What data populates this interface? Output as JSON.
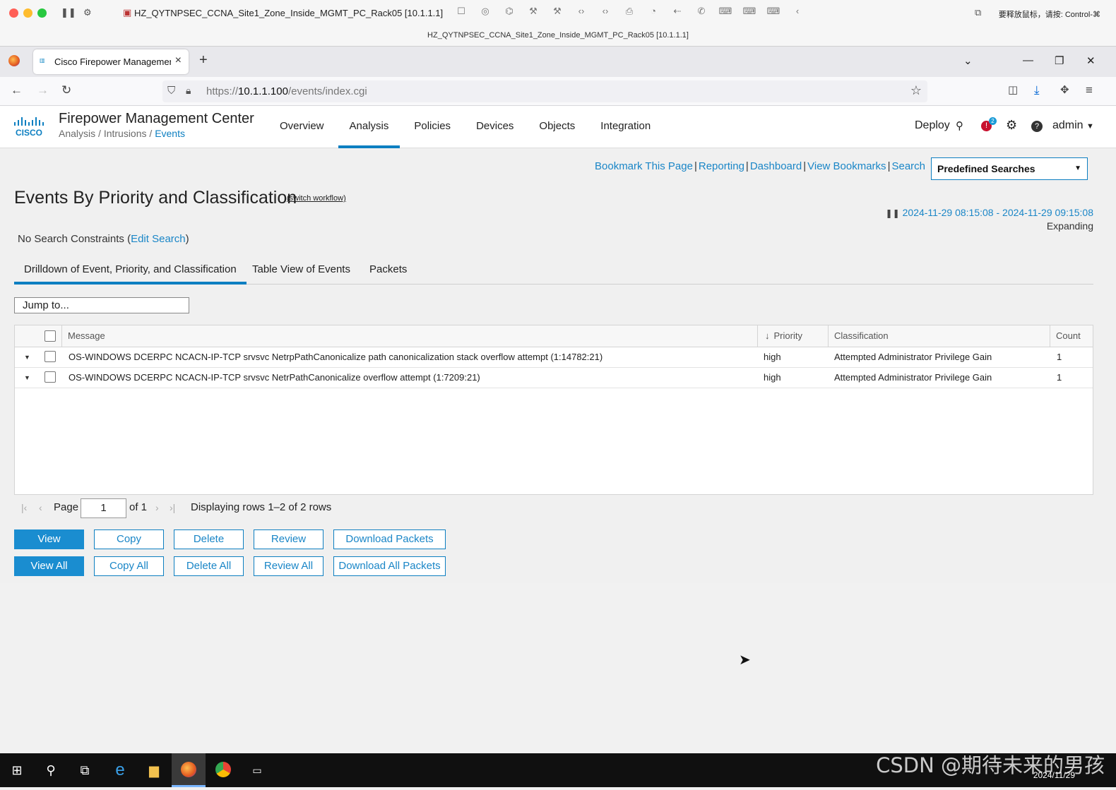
{
  "mac": {
    "title": "HZ_QYTNPSEC_CCNA_Site1_Zone_Inside_MGMT_PC_Rack05 [10.1.1.1]",
    "subtitle": "HZ_QYTNPSEC_CCNA_Site1_Zone_Inside_MGMT_PC_Rack05 [10.1.1.1]",
    "hint": "要释放鼠标，请按: Control-⌘"
  },
  "browser": {
    "tab_title": "Cisco Firepower Management Center",
    "url_prefix": "https://",
    "url_host": "10.1.1.100",
    "url_path": "/events/index.cgi"
  },
  "header": {
    "app_title": "Firepower Management Center",
    "breadcrumb": {
      "part1": "Analysis",
      "sep": " / ",
      "part2": "Intrusions",
      "part3": "Events"
    },
    "nav": [
      "Overview",
      "Analysis",
      "Policies",
      "Devices",
      "Objects",
      "Integration"
    ],
    "active_nav": "Analysis",
    "deploy": "Deploy",
    "alert_count": "2",
    "user": "admin"
  },
  "toolbar": {
    "links": [
      "Bookmark This Page",
      "Reporting",
      "Dashboard",
      "View Bookmarks",
      "Search"
    ],
    "predefined": "Predefined Searches"
  },
  "page": {
    "title": "Events By Priority and Classification",
    "switch_workflow": "(switch workflow)",
    "time_range": "2024-11-29 08:15:08 - 2024-11-29 09:15:08",
    "expanding": "Expanding",
    "constraints_text": "No Search Constraints (",
    "constraints_link": "Edit Search",
    "constraints_end": ")"
  },
  "subtabs": [
    "Drilldown of Event, Priority, and Classification",
    "Table View of Events",
    "Packets"
  ],
  "jump_to": "Jump to...",
  "table": {
    "headers": {
      "message": "Message",
      "priority": "Priority",
      "classification": "Classification",
      "count": "Count"
    },
    "rows": [
      {
        "message": "OS-WINDOWS DCERPC NCACN-IP-TCP srvsvc NetrpPathCanonicalize path canonicalization stack overflow attempt (1:14782:21)",
        "priority": "high",
        "classification": "Attempted Administrator Privilege Gain",
        "count": "1"
      },
      {
        "message": "OS-WINDOWS DCERPC NCACN-IP-TCP srvsvc NetrPathCanonicalize overflow attempt (1:7209:21)",
        "priority": "high",
        "classification": "Attempted Administrator Privilege Gain",
        "count": "1"
      }
    ]
  },
  "pager": {
    "page_label": "Page",
    "page_value": "1",
    "of_label": "of 1",
    "display": "Displaying rows 1–2 of 2 rows"
  },
  "buttons": {
    "row1": [
      "View",
      "Copy",
      "Delete",
      "Review",
      "Download Packets"
    ],
    "row2": [
      "View All",
      "Copy All",
      "Delete All",
      "Review All",
      "Download All Packets"
    ]
  },
  "taskbar": {
    "date": "2024/11/29",
    "watermark": "CSDN @期待未来的男孩"
  }
}
